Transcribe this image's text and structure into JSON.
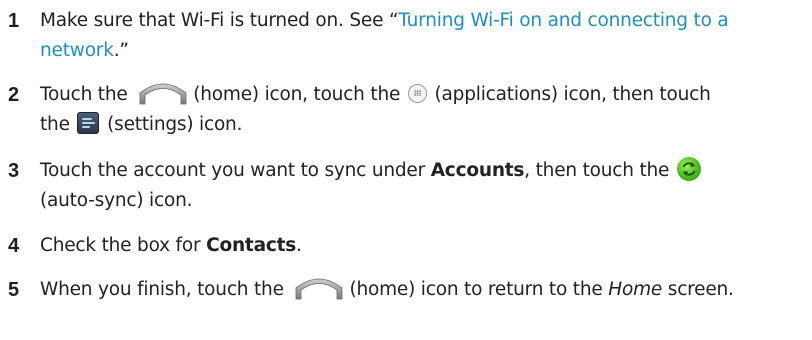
{
  "steps": [
    {
      "number": "1",
      "text_a": "Make sure that Wi-Fi is turned on. See “",
      "link": "Turning Wi-Fi on and connecting to a network",
      "text_b": ".”"
    },
    {
      "number": "2",
      "text_a": "Touch the ",
      "home_label": "(home) icon, touch the ",
      "apps_label": "(applications) icon, then touch the ",
      "settings_label": "(settings) icon."
    },
    {
      "number": "3",
      "text_a": "Touch the account you want to sync under ",
      "bold": "Accounts",
      "text_b": ", then touch the ",
      "sync_label": "(auto-sync) icon."
    },
    {
      "number": "4",
      "text_a": "Check the box for ",
      "bold": "Contacts",
      "text_b": "."
    },
    {
      "number": "5",
      "text_a": "When you finish, touch the ",
      "home_label": "(home) icon to return to the ",
      "italic": "Home",
      "text_b": " screen."
    }
  ],
  "colors": {
    "link": "#1f8fbf",
    "text": "#222222"
  },
  "icons": [
    "home-icon",
    "applications-icon",
    "settings-icon",
    "auto-sync-icon"
  ]
}
